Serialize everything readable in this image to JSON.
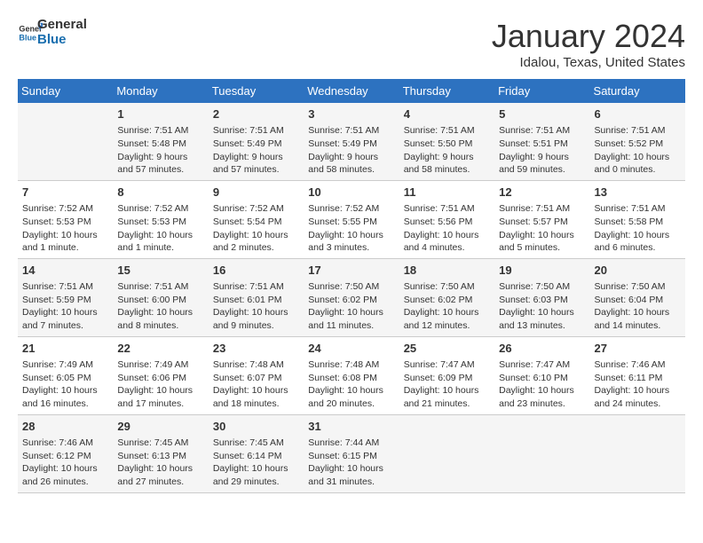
{
  "header": {
    "logo_general": "General",
    "logo_blue": "Blue",
    "month_title": "January 2024",
    "location": "Idalou, Texas, United States"
  },
  "days_of_week": [
    "Sunday",
    "Monday",
    "Tuesday",
    "Wednesday",
    "Thursday",
    "Friday",
    "Saturday"
  ],
  "weeks": [
    [
      {
        "day": "",
        "info": ""
      },
      {
        "day": "1",
        "info": "Sunrise: 7:51 AM\nSunset: 5:48 PM\nDaylight: 9 hours\nand 57 minutes."
      },
      {
        "day": "2",
        "info": "Sunrise: 7:51 AM\nSunset: 5:49 PM\nDaylight: 9 hours\nand 57 minutes."
      },
      {
        "day": "3",
        "info": "Sunrise: 7:51 AM\nSunset: 5:49 PM\nDaylight: 9 hours\nand 58 minutes."
      },
      {
        "day": "4",
        "info": "Sunrise: 7:51 AM\nSunset: 5:50 PM\nDaylight: 9 hours\nand 58 minutes."
      },
      {
        "day": "5",
        "info": "Sunrise: 7:51 AM\nSunset: 5:51 PM\nDaylight: 9 hours\nand 59 minutes."
      },
      {
        "day": "6",
        "info": "Sunrise: 7:51 AM\nSunset: 5:52 PM\nDaylight: 10 hours\nand 0 minutes."
      }
    ],
    [
      {
        "day": "7",
        "info": "Sunrise: 7:52 AM\nSunset: 5:53 PM\nDaylight: 10 hours\nand 1 minute."
      },
      {
        "day": "8",
        "info": "Sunrise: 7:52 AM\nSunset: 5:53 PM\nDaylight: 10 hours\nand 1 minute."
      },
      {
        "day": "9",
        "info": "Sunrise: 7:52 AM\nSunset: 5:54 PM\nDaylight: 10 hours\nand 2 minutes."
      },
      {
        "day": "10",
        "info": "Sunrise: 7:52 AM\nSunset: 5:55 PM\nDaylight: 10 hours\nand 3 minutes."
      },
      {
        "day": "11",
        "info": "Sunrise: 7:51 AM\nSunset: 5:56 PM\nDaylight: 10 hours\nand 4 minutes."
      },
      {
        "day": "12",
        "info": "Sunrise: 7:51 AM\nSunset: 5:57 PM\nDaylight: 10 hours\nand 5 minutes."
      },
      {
        "day": "13",
        "info": "Sunrise: 7:51 AM\nSunset: 5:58 PM\nDaylight: 10 hours\nand 6 minutes."
      }
    ],
    [
      {
        "day": "14",
        "info": "Sunrise: 7:51 AM\nSunset: 5:59 PM\nDaylight: 10 hours\nand 7 minutes."
      },
      {
        "day": "15",
        "info": "Sunrise: 7:51 AM\nSunset: 6:00 PM\nDaylight: 10 hours\nand 8 minutes."
      },
      {
        "day": "16",
        "info": "Sunrise: 7:51 AM\nSunset: 6:01 PM\nDaylight: 10 hours\nand 9 minutes."
      },
      {
        "day": "17",
        "info": "Sunrise: 7:50 AM\nSunset: 6:02 PM\nDaylight: 10 hours\nand 11 minutes."
      },
      {
        "day": "18",
        "info": "Sunrise: 7:50 AM\nSunset: 6:02 PM\nDaylight: 10 hours\nand 12 minutes."
      },
      {
        "day": "19",
        "info": "Sunrise: 7:50 AM\nSunset: 6:03 PM\nDaylight: 10 hours\nand 13 minutes."
      },
      {
        "day": "20",
        "info": "Sunrise: 7:50 AM\nSunset: 6:04 PM\nDaylight: 10 hours\nand 14 minutes."
      }
    ],
    [
      {
        "day": "21",
        "info": "Sunrise: 7:49 AM\nSunset: 6:05 PM\nDaylight: 10 hours\nand 16 minutes."
      },
      {
        "day": "22",
        "info": "Sunrise: 7:49 AM\nSunset: 6:06 PM\nDaylight: 10 hours\nand 17 minutes."
      },
      {
        "day": "23",
        "info": "Sunrise: 7:48 AM\nSunset: 6:07 PM\nDaylight: 10 hours\nand 18 minutes."
      },
      {
        "day": "24",
        "info": "Sunrise: 7:48 AM\nSunset: 6:08 PM\nDaylight: 10 hours\nand 20 minutes."
      },
      {
        "day": "25",
        "info": "Sunrise: 7:47 AM\nSunset: 6:09 PM\nDaylight: 10 hours\nand 21 minutes."
      },
      {
        "day": "26",
        "info": "Sunrise: 7:47 AM\nSunset: 6:10 PM\nDaylight: 10 hours\nand 23 minutes."
      },
      {
        "day": "27",
        "info": "Sunrise: 7:46 AM\nSunset: 6:11 PM\nDaylight: 10 hours\nand 24 minutes."
      }
    ],
    [
      {
        "day": "28",
        "info": "Sunrise: 7:46 AM\nSunset: 6:12 PM\nDaylight: 10 hours\nand 26 minutes."
      },
      {
        "day": "29",
        "info": "Sunrise: 7:45 AM\nSunset: 6:13 PM\nDaylight: 10 hours\nand 27 minutes."
      },
      {
        "day": "30",
        "info": "Sunrise: 7:45 AM\nSunset: 6:14 PM\nDaylight: 10 hours\nand 29 minutes."
      },
      {
        "day": "31",
        "info": "Sunrise: 7:44 AM\nSunset: 6:15 PM\nDaylight: 10 hours\nand 31 minutes."
      },
      {
        "day": "",
        "info": ""
      },
      {
        "day": "",
        "info": ""
      },
      {
        "day": "",
        "info": ""
      }
    ]
  ]
}
